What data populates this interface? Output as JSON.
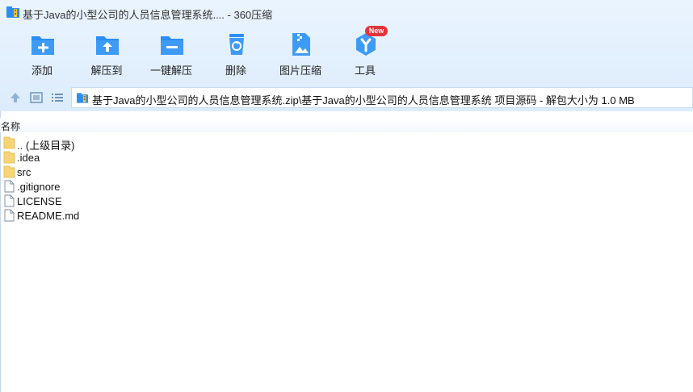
{
  "window": {
    "title": "基于Java的小型公司的人员信息管理系统.... - 360压缩"
  },
  "toolbar": {
    "add": "添加",
    "extract_to": "解压到",
    "one_click_extract": "一键解压",
    "delete": "删除",
    "image_compress": "图片压缩",
    "tools": "工具",
    "new_badge": "New"
  },
  "address_bar": {
    "path": "基于Java的小型公司的人员信息管理系统.zip\\基于Java的小型公司的人员信息管理系统 项目源码 - 解包大小为 1.0 MB"
  },
  "file_list": {
    "column_name": "名称",
    "items": [
      {
        "name": ".. (上级目录)",
        "type": "folder"
      },
      {
        "name": ".idea",
        "type": "folder"
      },
      {
        "name": "src",
        "type": "folder"
      },
      {
        "name": ".gitignore",
        "type": "file"
      },
      {
        "name": "LICENSE",
        "type": "file"
      },
      {
        "name": "README.md",
        "type": "file"
      }
    ]
  },
  "colors": {
    "accent_blue": "#2c8ef4",
    "folder_yellow": "#f7d577",
    "badge_red": "#e8333a"
  }
}
